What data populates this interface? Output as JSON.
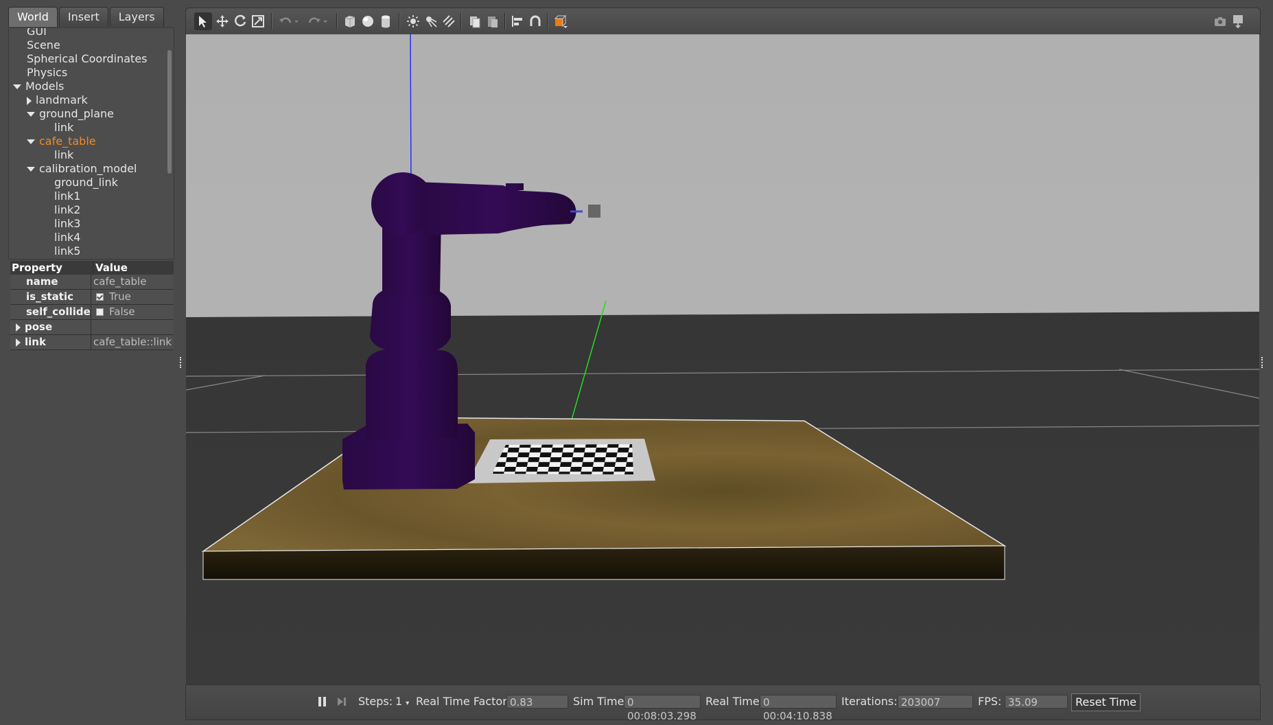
{
  "tabs": [
    {
      "label": "World",
      "active": true
    },
    {
      "label": "Insert",
      "active": false
    },
    {
      "label": "Layers",
      "active": false
    }
  ],
  "tree": {
    "items": [
      {
        "label": "GUI",
        "expander": "none",
        "selected": false
      },
      {
        "label": "Scene",
        "expander": "none",
        "selected": false
      },
      {
        "label": "Spherical Coordinates",
        "expander": "none",
        "selected": false
      },
      {
        "label": "Physics",
        "expander": "none",
        "selected": false
      },
      {
        "label": "Models",
        "expander": "expanded",
        "selected": false
      },
      {
        "label": "landmark",
        "expander": "collapsed",
        "selected": false
      },
      {
        "label": "ground_plane",
        "expander": "expanded",
        "selected": false
      },
      {
        "label": "link",
        "expander": "none",
        "selected": false
      },
      {
        "label": "cafe_table",
        "expander": "expanded",
        "selected": true
      },
      {
        "label": "link",
        "expander": "none",
        "selected": false
      },
      {
        "label": "calibration_model",
        "expander": "expanded",
        "selected": false
      },
      {
        "label": "ground_link",
        "expander": "none",
        "selected": false
      },
      {
        "label": "link1",
        "expander": "none",
        "selected": false
      },
      {
        "label": "link2",
        "expander": "none",
        "selected": false
      },
      {
        "label": "link3",
        "expander": "none",
        "selected": false
      },
      {
        "label": "link4",
        "expander": "none",
        "selected": false
      },
      {
        "label": "link5",
        "expander": "none",
        "selected": false
      }
    ]
  },
  "properties": {
    "header": {
      "property": "Property",
      "value": "Value"
    },
    "rows": [
      {
        "key": "name",
        "value": "cafe_table",
        "type": "text"
      },
      {
        "key": "is_static",
        "value": "True",
        "type": "checkbox",
        "checked": true
      },
      {
        "key": "self_collide",
        "value": "False",
        "type": "checkbox",
        "checked": false
      },
      {
        "key": "pose",
        "value": "",
        "type": "group"
      },
      {
        "key": "link",
        "value": "cafe_table::link",
        "type": "group"
      }
    ]
  },
  "toolbar": {
    "icons": [
      "select-arrow-icon",
      "translate-icon",
      "rotate-icon",
      "scale-icon",
      "undo-icon",
      "undo-dropdown-icon",
      "redo-icon",
      "redo-dropdown-icon",
      "box-icon",
      "sphere-icon",
      "cylinder-icon",
      "point-light-icon",
      "spot-light-icon",
      "directional-light-icon",
      "copy-icon",
      "paste-icon",
      "align-icon",
      "snap-icon",
      "view-angle-icon",
      "screenshot-icon",
      "log-icon"
    ]
  },
  "bottom_bar": {
    "steps_label": "Steps:",
    "steps_value": "1",
    "rtf_label": "Real Time Factor:",
    "rtf_value": "0.83",
    "sim_time_label": "Sim Time:",
    "sim_time_value": "0 00:08:03.298",
    "real_time_label": "Real Time:",
    "real_time_value": "0 00:04:10.838",
    "iterations_label": "Iterations:",
    "iterations_value": "203007",
    "fps_label": "FPS:",
    "fps_value": "35.09",
    "reset_label": "Reset Time"
  },
  "colors": {
    "selected_item": "#f08a24",
    "robot": "#2e0a4a",
    "table_top": "#6e5a2c",
    "sky": "#b1b1b1",
    "ground": "#3b3b3b"
  }
}
